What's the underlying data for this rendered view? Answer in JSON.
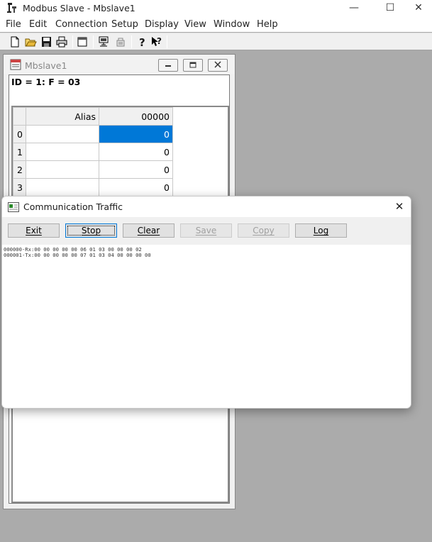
{
  "app": {
    "title": "Modbus Slave - Mbslave1",
    "window_controls": {
      "minimize": "—",
      "maximize": "☐",
      "close": "✕"
    }
  },
  "menu": [
    "File",
    "Edit",
    "Connection",
    "Setup",
    "Display",
    "View",
    "Window",
    "Help"
  ],
  "toolbar": {
    "icons": [
      "new-document-icon",
      "open-folder-icon",
      "save-disk-icon",
      "print-icon",
      "window-icon",
      "connect-icon",
      "disconnect-icon",
      "help-icon",
      "context-help-icon"
    ]
  },
  "child_window": {
    "title": "Mbslave1",
    "id_label": "ID = 1: F = 03",
    "grid": {
      "alias_header": "Alias",
      "value_header": "00000",
      "rows": [
        {
          "index": "0",
          "alias": "",
          "value": "0",
          "selected": true
        },
        {
          "index": "1",
          "alias": "",
          "value": "0"
        },
        {
          "index": "2",
          "alias": "",
          "value": "0"
        },
        {
          "index": "3",
          "alias": "",
          "value": "0"
        }
      ]
    }
  },
  "traffic_dialog": {
    "title": "Communication Traffic",
    "buttons": {
      "exit": "Exit",
      "stop": "Stop",
      "clear": "Clear",
      "save": "Save",
      "copy": "Copy",
      "log": "Log"
    },
    "log_lines": [
      "000000-Rx:00 00 00 00 00 06 01 03 00 00 00 02",
      "000001-Tx:00 00 00 00 00 07 01 03 04 00 00 00 00"
    ]
  }
}
